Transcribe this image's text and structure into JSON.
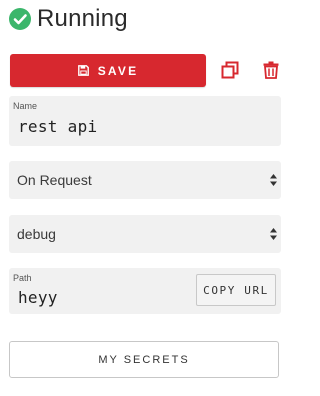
{
  "status": {
    "text": "Running",
    "icon": "check-circle-icon",
    "color": "#3bb66b"
  },
  "toolbar": {
    "save_label": "SAVE",
    "save_icon": "floppy-disk-icon",
    "save_color": "#d7282f",
    "duplicate_icon": "duplicate-icon",
    "delete_icon": "trash-icon",
    "icon_color": "#d7282f"
  },
  "form": {
    "name": {
      "label": "Name",
      "value": "rest api"
    },
    "trigger": {
      "selected": "On Request"
    },
    "log_level": {
      "selected": "debug"
    },
    "path": {
      "label": "Path",
      "value": "heyy",
      "copy_label": "COPY URL"
    }
  },
  "secrets": {
    "button_label": "MY SECRETS"
  }
}
